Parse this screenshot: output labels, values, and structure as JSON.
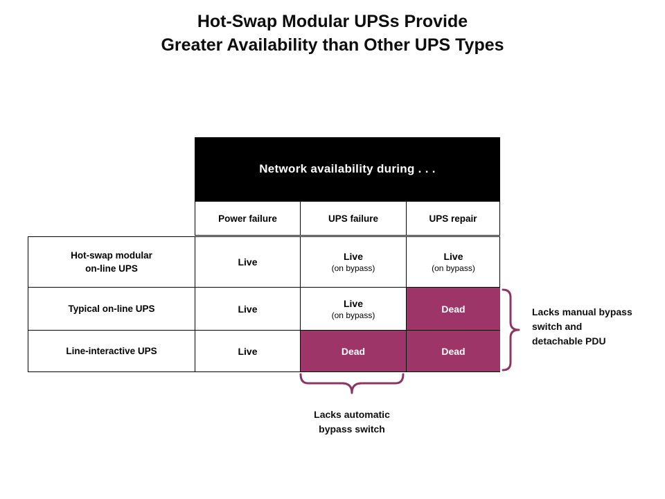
{
  "slide": {
    "title_lines": [
      "Hot-Swap Modular UPSs Provide",
      "Greater Availability than Other UPS Types"
    ],
    "background_color": "#FFFFFF"
  },
  "colors": {
    "dead_fill": "#9E3569",
    "brace_stroke": "#8E3561",
    "banner_fill": "#000000",
    "banner_text": "#FFFFFF",
    "grid_line": "#000000",
    "text": "#0D0D0D"
  },
  "matrix": {
    "banner_label": "Network availability during . . .",
    "column_headers": [
      "Power failure",
      "UPS failure",
      "UPS repair"
    ],
    "rows": [
      {
        "label_lines": [
          "Hot-swap modular",
          "on-line UPS"
        ],
        "cells": [
          {
            "state": "live",
            "primary": "Live",
            "secondary": ""
          },
          {
            "state": "live",
            "primary": "Live",
            "secondary": "(on bypass)"
          },
          {
            "state": "live",
            "primary": "Live",
            "secondary": "(on bypass)"
          }
        ]
      },
      {
        "label_lines": [
          "Typical on-line UPS"
        ],
        "cells": [
          {
            "state": "live",
            "primary": "Live",
            "secondary": ""
          },
          {
            "state": "live",
            "primary": "Live",
            "secondary": "(on bypass)"
          },
          {
            "state": "dead",
            "primary": "Dead",
            "secondary": ""
          }
        ]
      },
      {
        "label_lines": [
          "Line-interactive UPS"
        ],
        "cells": [
          {
            "state": "live",
            "primary": "Live",
            "secondary": ""
          },
          {
            "state": "dead",
            "primary": "Dead",
            "secondary": ""
          },
          {
            "state": "dead",
            "primary": "Dead",
            "secondary": ""
          }
        ]
      }
    ]
  },
  "annotations": {
    "right": {
      "lines": [
        "Lacks manual bypass",
        "switch and",
        "detachable PDU"
      ]
    },
    "bottom": {
      "lines": [
        "Lacks automatic",
        "bypass switch"
      ]
    }
  }
}
